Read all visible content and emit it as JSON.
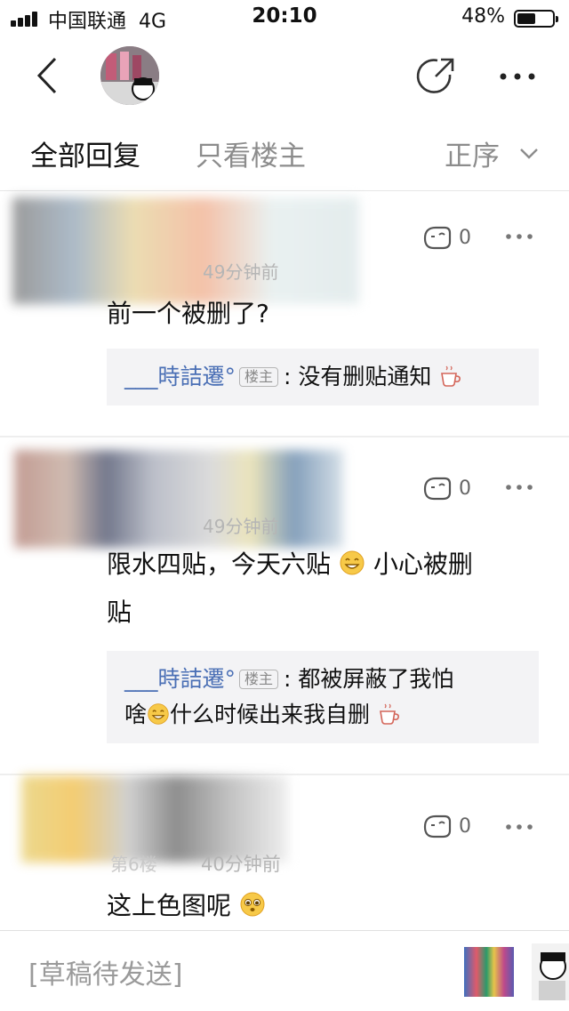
{
  "status_bar": {
    "carrier": "中国联通",
    "network": "4G",
    "time": "20:10",
    "battery": "48%"
  },
  "tabs": {
    "all_replies": "全部回复",
    "op_only": "只看楼主",
    "sort": "正序"
  },
  "posts": [
    {
      "meta": "49分钟前",
      "likes": "0",
      "content": "前一个被删了?",
      "reply": {
        "author": "___時詰遷°",
        "badge": "楼主",
        "text": "没有删贴通知"
      }
    },
    {
      "meta": "49分钟前",
      "likes": "0",
      "content_part1": "限水四贴，今天六贴",
      "content_part2": "小心被删",
      "content_part3": "贴",
      "reply": {
        "author": "___時詰遷°",
        "badge": "楼主",
        "text_part1": "都被屏蔽了我怕",
        "text_part2": "啥",
        "text_part3": "什么时候出来我自删"
      }
    },
    {
      "floor": "第6楼",
      "meta": "40分钟前",
      "likes": "0",
      "content": "这上色图呢"
    }
  ],
  "bottom_bar": {
    "draft_placeholder": "[草稿待发送]"
  },
  "colors": {
    "reply_name": "#4a6fb5",
    "muted": "#8c8c8c",
    "reply_bg": "#f3f3f5"
  }
}
